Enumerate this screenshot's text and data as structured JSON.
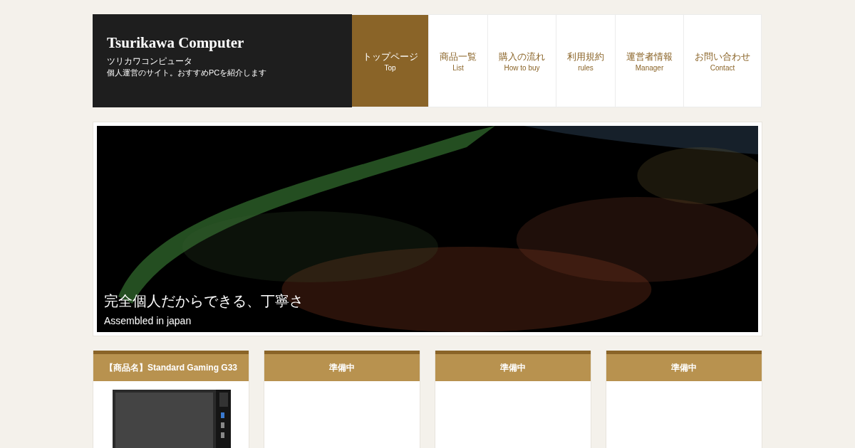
{
  "site": {
    "title": "Tsurikawa Computer",
    "subtitle": "ツリカワコンピュータ",
    "description": "個人運営のサイト。おすすめPCを紹介します"
  },
  "nav": [
    {
      "label": "トップページ",
      "sublabel": "Top",
      "selected": true
    },
    {
      "label": "商品一覧",
      "sublabel": "List",
      "selected": false
    },
    {
      "label": "購入の流れ",
      "sublabel": "How to buy",
      "selected": false
    },
    {
      "label": "利用規約",
      "sublabel": "rules",
      "selected": false
    },
    {
      "label": "運営者情報",
      "sublabel": "Manager",
      "selected": false
    },
    {
      "label": "お問い合わせ",
      "sublabel": "Contact",
      "selected": false
    }
  ],
  "hero": {
    "kind": "picture",
    "headline": "完全個人だからできる、丁寧さ",
    "caption": "Assembled in japan"
  },
  "cards": [
    {
      "title": "【商品名】Standard Gaming G33"
    },
    {
      "title": "準備中"
    },
    {
      "title": "準備中"
    },
    {
      "title": "準備中"
    }
  ]
}
